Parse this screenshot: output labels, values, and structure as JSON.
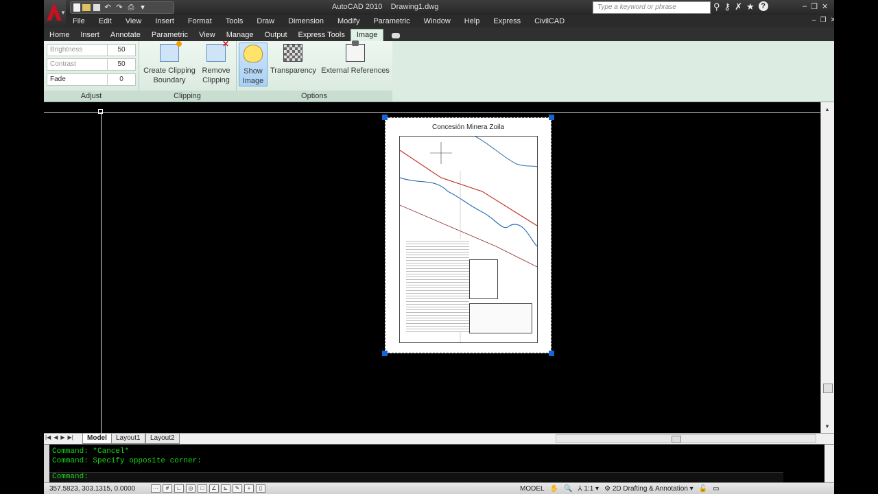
{
  "window": {
    "app": "AutoCAD 2010",
    "document": "Drawing1.dwg"
  },
  "search": {
    "placeholder": "Type a keyword or phrase"
  },
  "menu": [
    "File",
    "Edit",
    "View",
    "Insert",
    "Format",
    "Tools",
    "Draw",
    "Dimension",
    "Modify",
    "Parametric",
    "Window",
    "Help",
    "Express",
    "CivilCAD"
  ],
  "ribbon_tabs": [
    "Home",
    "Insert",
    "Annotate",
    "Parametric",
    "View",
    "Manage",
    "Output",
    "Express Tools",
    "Image"
  ],
  "ribbon_active_tab": "Image",
  "adjust": {
    "title": "Adjust",
    "brightness": {
      "label": "Brightness",
      "value": "50"
    },
    "contrast": {
      "label": "Contrast",
      "value": "50"
    },
    "fade": {
      "label": "Fade",
      "value": "0"
    }
  },
  "clipping": {
    "title": "Clipping",
    "create_line1": "Create Clipping",
    "create_line2": "Boundary",
    "remove_line1": "Remove",
    "remove_line2": "Clipping"
  },
  "options": {
    "title": "Options",
    "show_line1": "Show",
    "show_line2": "Image",
    "transparency": "Transparency",
    "xref": "External References"
  },
  "image": {
    "title": "Concesión Minera Zoila"
  },
  "layout_tabs": [
    "Model",
    "Layout1",
    "Layout2"
  ],
  "command": {
    "line1": "Command: *Cancel*",
    "line2": "Command: Specify opposite corner:",
    "prompt": "Command:"
  },
  "status": {
    "coords": "357.5823, 303.1315, 0.0000",
    "model": "MODEL",
    "scale": "1:1",
    "workspace": "2D Drafting & Annotation"
  },
  "icons": [
    "app-menu-icon",
    "new-icon",
    "open-icon",
    "save-icon",
    "undo-icon",
    "redo-icon",
    "plot-icon",
    "binoculars-icon",
    "key-icon",
    "x-icon",
    "star-icon",
    "help-icon"
  ]
}
